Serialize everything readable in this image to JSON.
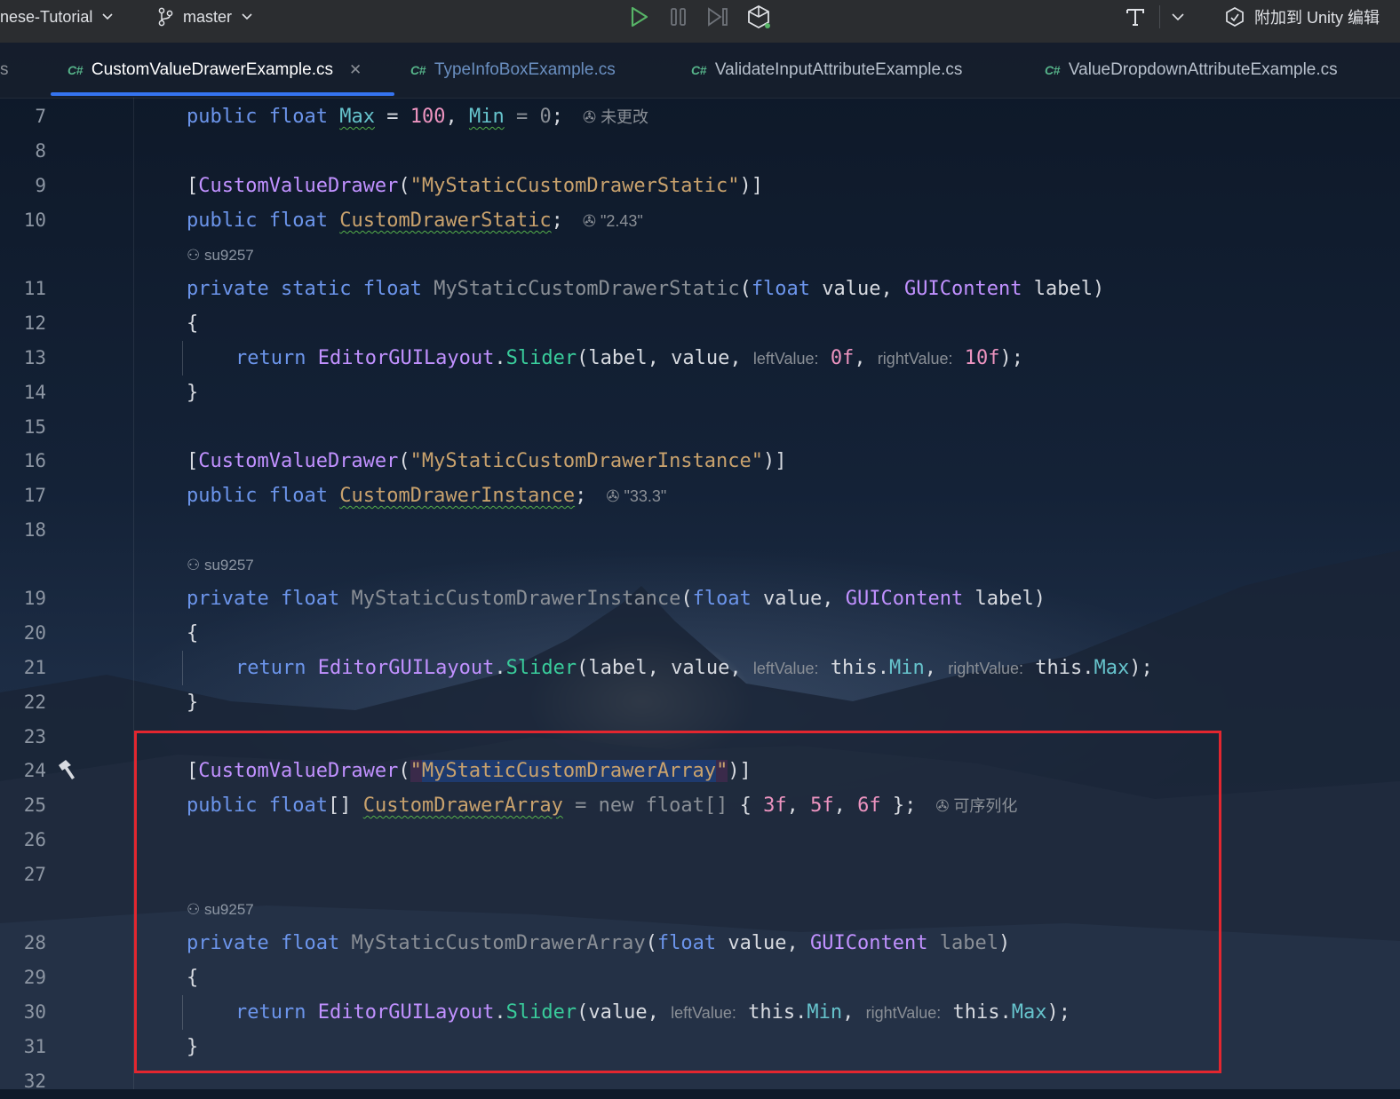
{
  "toolbar": {
    "project": "nese-Tutorial",
    "branch": "master",
    "attach_label": "附加到 Unity 编辑"
  },
  "tabs": [
    {
      "lang": "C#",
      "name": "CustomValueDrawerExample.cs",
      "active": true
    },
    {
      "lang": "C#",
      "name": "TypeInfoBoxExample.cs"
    },
    {
      "lang": "C#",
      "name": "ValidateInputAttributeExample.cs"
    },
    {
      "lang": "C#",
      "name": "ValueDropdownAttributeExample.cs"
    }
  ],
  "line_numbers": [
    "7",
    "8",
    "9",
    "10",
    "11",
    "12",
    "13",
    "14",
    "15",
    "16",
    "17",
    "18",
    "19",
    "20",
    "21",
    "22",
    "23",
    "24",
    "25",
    "26",
    "27",
    "28",
    "29",
    "30",
    "31",
    "32"
  ],
  "code": {
    "l7": {
      "public": "public",
      "float": "float",
      "max": "Max",
      "eq": " = ",
      "v100": "100",
      "sep": ", ",
      "min": "Min",
      "eq2": " = ",
      "v0": "0",
      "semi": ";",
      "hint": "未更改"
    },
    "l9": {
      "attr_open": "[",
      "attr": "CustomValueDrawer",
      "paren_open": "(",
      "str": "\"MyStaticCustomDrawerStatic\"",
      "close": ")]"
    },
    "l10": {
      "public": "public",
      "float": "float",
      "field": "CustomDrawerStatic",
      "semi": ";",
      "hint": "\"2.43\""
    },
    "author1": "su9257",
    "l11": {
      "private": "private",
      "static": "static",
      "float": "float",
      "method": "MyStaticCustomDrawerStatic",
      "p1": "(",
      "float2": "float",
      "value": " value, ",
      "type": "GUIContent",
      "label": " label)"
    },
    "l12": "{",
    "l13": {
      "return": "return",
      "class": "EditorGUILayout",
      "dot": ".",
      "method": "Slider",
      "args": "(label, value, ",
      "h1": "leftValue:",
      "v1": "0f",
      "sep": ", ",
      "h2": "rightValue:",
      "v2": "10f",
      "end": ");"
    },
    "l14": "}",
    "l16": {
      "attr_open": "[",
      "attr": "CustomValueDrawer",
      "paren_open": "(",
      "str": "\"MyStaticCustomDrawerInstance\"",
      "close": ")]"
    },
    "l17": {
      "public": "public",
      "float": "float",
      "field": "CustomDrawerInstance",
      "semi": ";",
      "hint": "\"33.3\""
    },
    "author2": "su9257",
    "l19": {
      "private": "private",
      "float": "float",
      "method": "MyStaticCustomDrawerInstance",
      "p1": "(",
      "float2": "float",
      "value": " value, ",
      "type": "GUIContent",
      "label": " label)"
    },
    "l20": "{",
    "l21": {
      "return": "return",
      "class": "EditorGUILayout",
      "dot": ".",
      "method": "Slider",
      "args": "(label, value, ",
      "h1": "leftValue:",
      "this1": "this",
      "dot1": ".",
      "m1": "Min",
      "sep": ", ",
      "h2": "rightValue:",
      "this2": "this",
      "dot2": ".",
      "m2": "Max",
      "end": ");"
    },
    "l22": "}",
    "l24": {
      "attr_open": "[",
      "attr": "CustomValueDrawer",
      "paren_open": "(",
      "q1": "\"",
      "str": "MyStaticCustomDrawerArray",
      "q2": "\"",
      "close": ")]"
    },
    "l25": {
      "public": "public",
      "float": "float",
      "arr": "[]",
      "field": "CustomDrawerArray",
      "rest": " = new float[] ",
      "brace": "{ ",
      "v1": "3f",
      "sep1": ", ",
      "v2": "5f",
      "sep2": ", ",
      "v3": "6f",
      "end": " };",
      "hint": "可序列化"
    },
    "author3": "su9257",
    "l28": {
      "private": "private",
      "float": "float",
      "method": "MyStaticCustomDrawerArray",
      "p1": "(",
      "float2": "float",
      "value": " value, ",
      "type": "GUIContent",
      "label": "label",
      "close": ")"
    },
    "l29": "{",
    "l30": {
      "return": "return",
      "class": "EditorGUILayout",
      "dot": ".",
      "method": "Slider",
      "args": "(value, ",
      "h1": "leftValue:",
      "this1": "this",
      "dot1": ".",
      "m1": "Min",
      "sep": ", ",
      "h2": "rightValue:",
      "this2": "this",
      "dot2": ".",
      "m2": "Max",
      "end": ");"
    },
    "l31": "}"
  },
  "colors": {
    "accent": "#3574f0",
    "highlight_box": "#e3262f",
    "keyword": "#6c95eb",
    "number": "#ed94c0",
    "string": "#c9a26d",
    "method": "#39cc9b"
  }
}
